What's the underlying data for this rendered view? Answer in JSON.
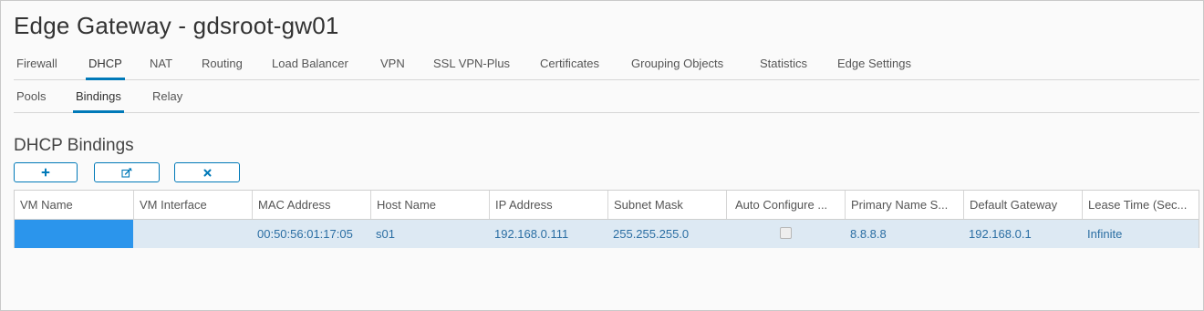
{
  "header": {
    "title": "Edge Gateway - gdsroot-gw01"
  },
  "tabs": [
    {
      "label": "Firewall",
      "active": false
    },
    {
      "label": "DHCP",
      "active": true
    },
    {
      "label": "NAT",
      "active": false
    },
    {
      "label": "Routing",
      "active": false
    },
    {
      "label": "Load Balancer",
      "active": false
    },
    {
      "label": "VPN",
      "active": false
    },
    {
      "label": "SSL VPN-Plus",
      "active": false
    },
    {
      "label": "Certificates",
      "active": false
    },
    {
      "label": "Grouping Objects",
      "active": false
    },
    {
      "label": "Statistics",
      "active": false
    },
    {
      "label": "Edge Settings",
      "active": false
    }
  ],
  "subtabs": [
    {
      "label": "Pools",
      "active": false
    },
    {
      "label": "Bindings",
      "active": true
    },
    {
      "label": "Relay",
      "active": false
    }
  ],
  "section": {
    "title": "DHCP Bindings"
  },
  "toolbar": {
    "add_icon": "plus-icon",
    "edit_icon": "edit-icon",
    "delete_icon": "close-icon"
  },
  "table": {
    "columns": [
      "VM Name",
      "VM Interface",
      "MAC Address",
      "Host Name",
      "IP Address",
      "Subnet Mask",
      "Auto Configure ...",
      "Primary Name S...",
      "Default Gateway",
      "Lease Time (Sec..."
    ],
    "rows": [
      {
        "vm_name": "",
        "vm_interface": "",
        "mac": "00:50:56:01:17:05",
        "host": "s01",
        "ip": "192.168.0.111",
        "subnet": "255.255.255.0",
        "auto_configure": false,
        "primary_ns": "8.8.8.8",
        "gateway": "192.168.0.1",
        "lease": "Infinite"
      }
    ]
  },
  "colors": {
    "accent": "#0079b8",
    "selected_cell": "#2b95ec",
    "row_highlight": "#dde9f3",
    "link_text": "#2b6ea3"
  }
}
